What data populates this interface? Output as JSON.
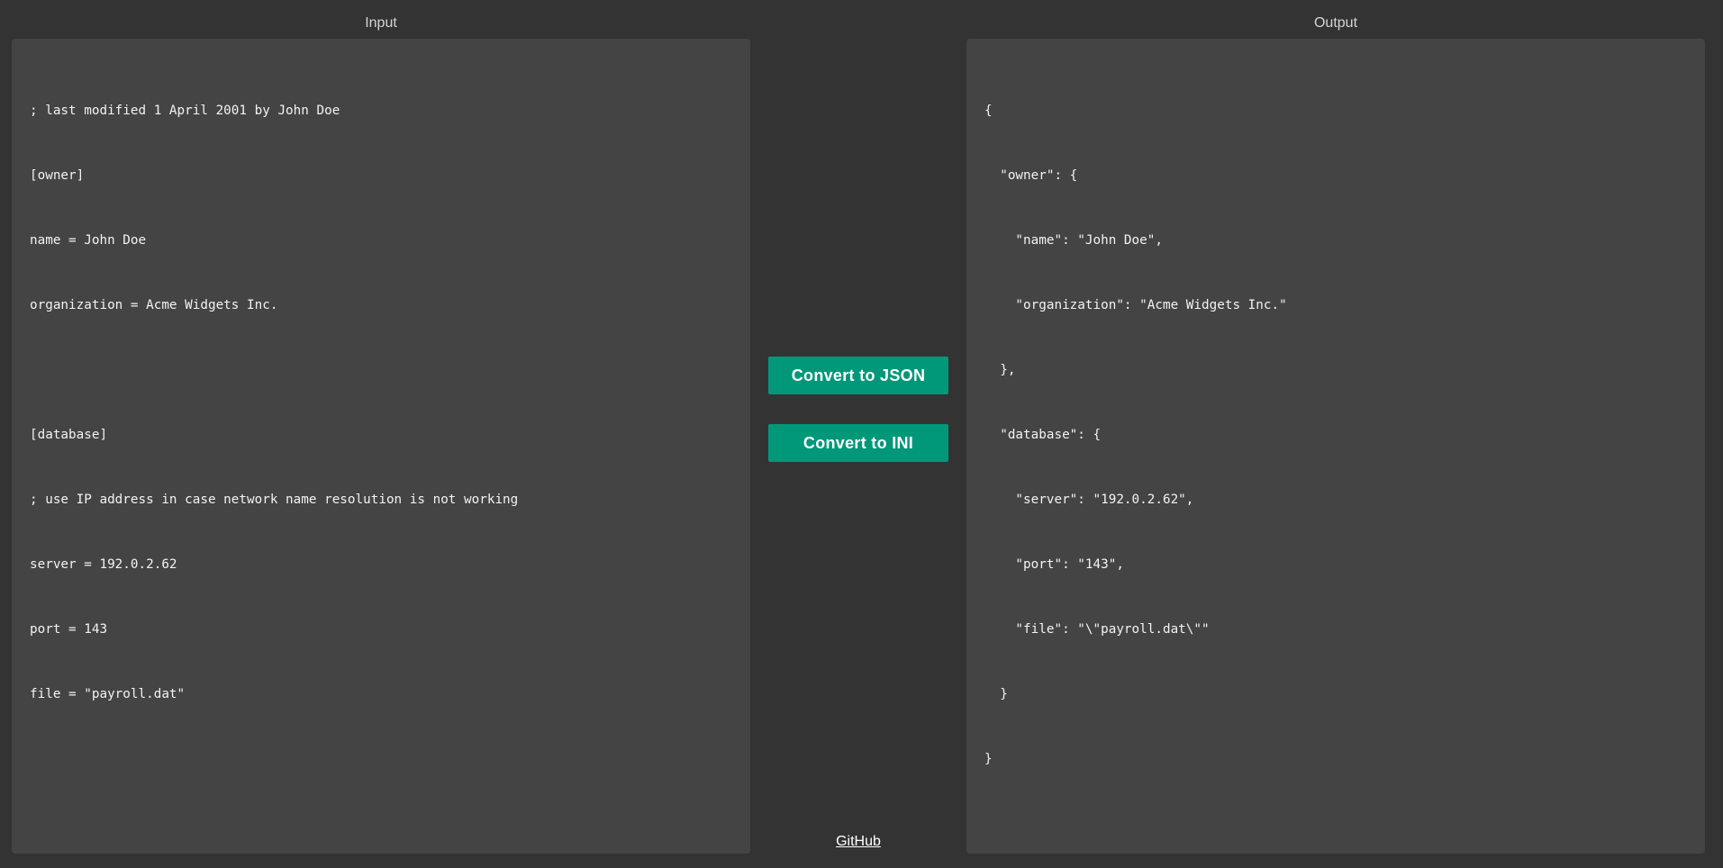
{
  "input": {
    "title": "Input",
    "lines": [
      "; last modified 1 April 2001 by John Doe",
      "[owner]",
      "name = John Doe",
      "organization = Acme Widgets Inc.",
      "",
      "[database]",
      "; use IP address in case network name resolution is not working",
      "server = 192.0.2.62",
      "port = 143",
      "file = \"payroll.dat\""
    ]
  },
  "output": {
    "title": "Output",
    "lines": [
      "{",
      "  \"owner\": {",
      "    \"name\": \"John Doe\",",
      "    \"organization\": \"Acme Widgets Inc.\"",
      "  },",
      "  \"database\": {",
      "    \"server\": \"192.0.2.62\",",
      "    \"port\": \"143\",",
      "    \"file\": \"\\\"payroll.dat\\\"\"",
      "  }",
      "}"
    ]
  },
  "buttons": {
    "to_json": "Convert to JSON",
    "to_ini": "Convert to INI"
  },
  "footer": {
    "github_label": "GitHub"
  },
  "colors": {
    "background": "#333333",
    "panel": "#444444",
    "button": "#009879"
  }
}
